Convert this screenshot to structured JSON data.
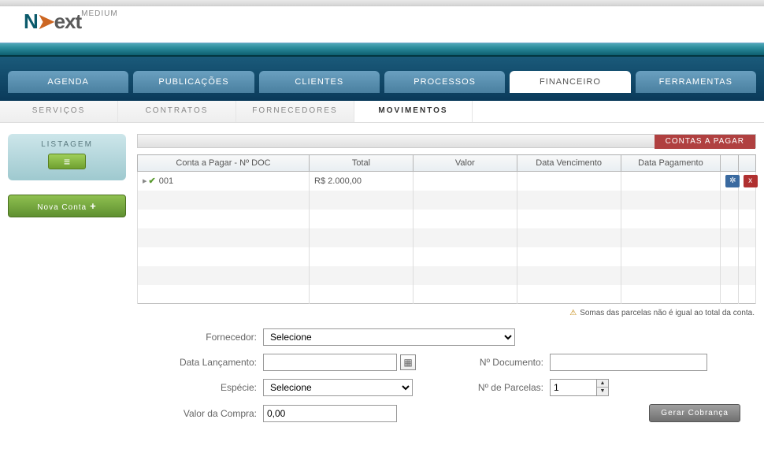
{
  "logo": {
    "brand_n": "N",
    "brand_ext": "ext",
    "suffix": "MEDIUM"
  },
  "mainnav": {
    "agenda": "AGENDA",
    "publicacoes": "PUBLICAÇÕES",
    "clientes": "CLIENTES",
    "processos": "PROCESSOS",
    "financeiro": "FINANCEIRO",
    "ferramentas": "FERRAMENTAS"
  },
  "subnav": {
    "servicos": "SERVIÇOS",
    "contratos": "CONTRATOS",
    "fornecedores": "FORNECEDORES",
    "movimentos": "MOVIMENTOS"
  },
  "sidebar": {
    "listagem": "LISTAGEM",
    "nova_conta": "Nova Conta"
  },
  "section_title": "CONTAS A PAGAR",
  "grid": {
    "headers": {
      "doc": "Conta a Pagar - Nº DOC",
      "total": "Total",
      "valor": "Valor",
      "venc": "Data Vencimento",
      "pag": "Data Pagamento"
    },
    "rows": [
      {
        "doc": "001",
        "total": "R$ 2.000,00",
        "valor": "",
        "venc": "",
        "pag": ""
      }
    ]
  },
  "warning": "Somas das parcelas não é igual ao total da conta.",
  "form": {
    "fornecedor_label": "Fornecedor:",
    "fornecedor_placeholder": "Selecione",
    "data_lanc_label": "Data Lançamento:",
    "num_doc_label": "Nº Documento:",
    "especie_label": "Espécie:",
    "especie_placeholder": "Selecione",
    "num_parc_label": "Nº de Parcelas:",
    "num_parc_value": "1",
    "valor_compra_label": "Valor da Compra:",
    "valor_compra_value": "0,00",
    "gerar_btn": "Gerar Cobrança"
  }
}
